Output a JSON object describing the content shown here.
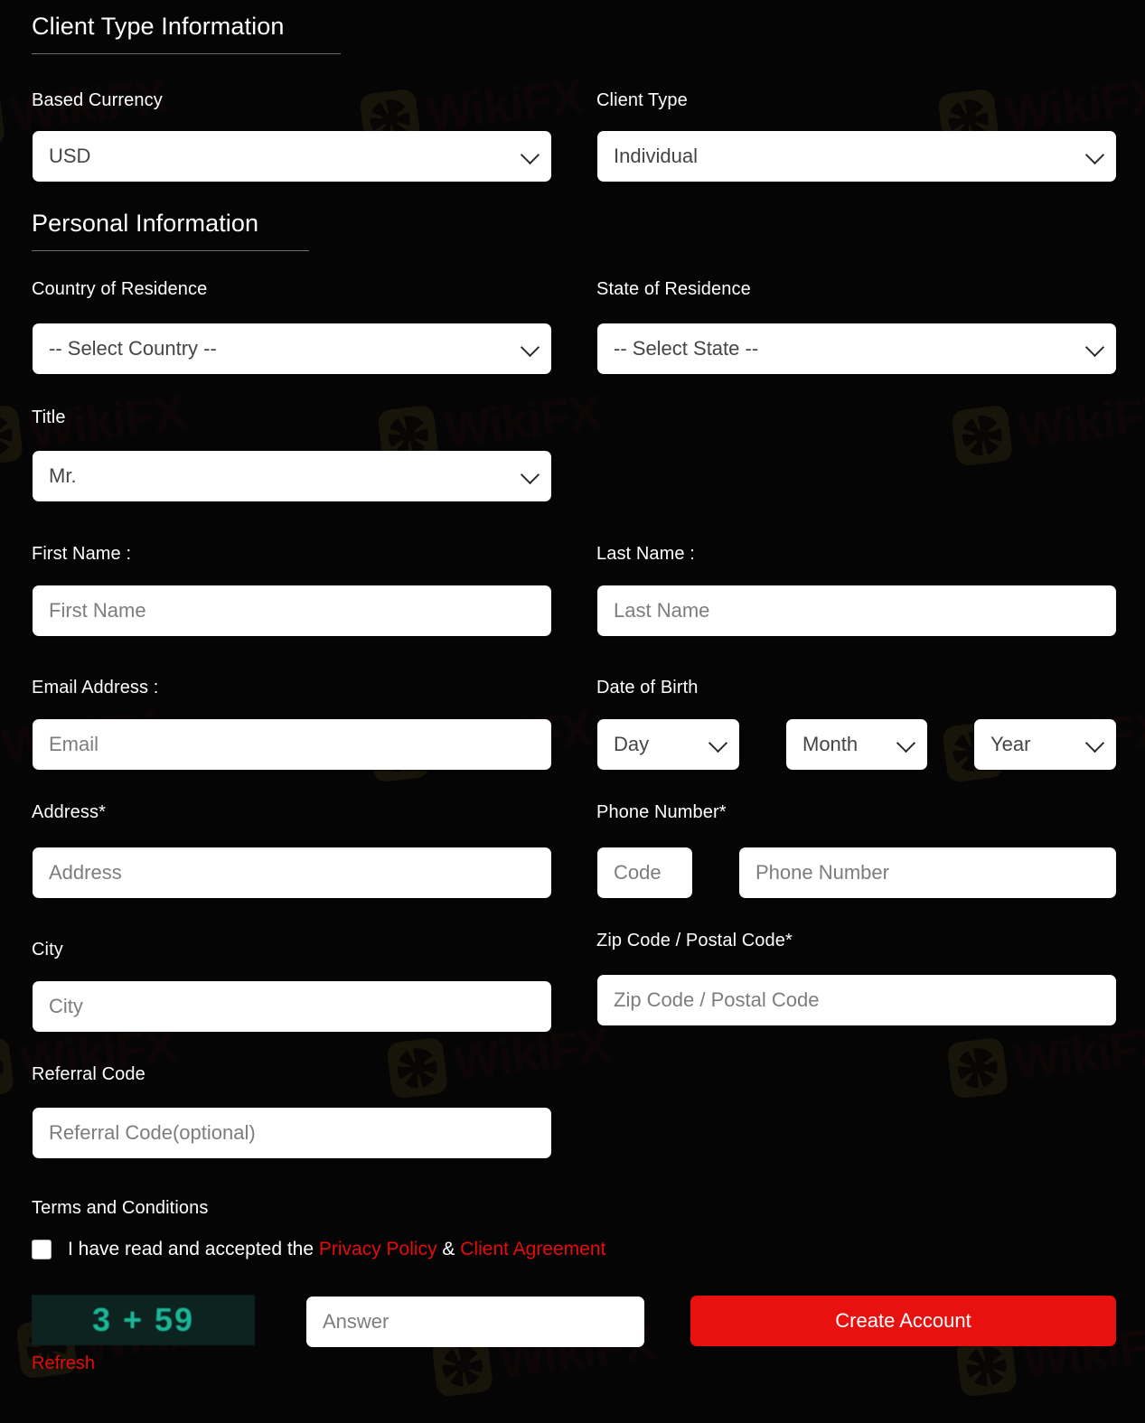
{
  "sections": {
    "client_type": {
      "title": "Client Type Information"
    },
    "personal": {
      "title": "Personal Information"
    }
  },
  "fields": {
    "based_currency": {
      "label": "Based Currency",
      "value": "USD"
    },
    "client_type": {
      "label": "Client Type",
      "value": "Individual"
    },
    "country": {
      "label": "Country of Residence",
      "value": "-- Select Country --"
    },
    "state": {
      "label": "State of Residence",
      "value": "-- Select State --"
    },
    "title": {
      "label": "Title",
      "value": "Mr."
    },
    "first_name": {
      "label": "First Name :",
      "placeholder": "First Name",
      "value": ""
    },
    "last_name": {
      "label": "Last Name :",
      "placeholder": "Last Name",
      "value": ""
    },
    "email": {
      "label": "Email Address :",
      "placeholder": "Email",
      "value": ""
    },
    "dob": {
      "label": "Date of Birth",
      "day": "Day",
      "month": "Month",
      "year": "Year"
    },
    "address": {
      "label": "Address*",
      "placeholder": "Address",
      "value": ""
    },
    "phone": {
      "label": "Phone Number*",
      "code_placeholder": "Code",
      "number_placeholder": "Phone Number",
      "code_value": "",
      "number_value": ""
    },
    "city": {
      "label": "City",
      "placeholder": "City",
      "value": ""
    },
    "zip": {
      "label": "Zip Code / Postal Code*",
      "placeholder": "Zip Code / Postal Code",
      "value": ""
    },
    "referral": {
      "label": "Referral Code",
      "placeholder": "Referral Code(optional)",
      "value": ""
    }
  },
  "terms": {
    "label": "Terms and Conditions",
    "accept_prefix": "I have read and accepted the ",
    "privacy_policy": "Privacy Policy",
    "separator": " & ",
    "client_agreement": "Client Agreement",
    "checked": false
  },
  "captcha": {
    "challenge": "3 + 59",
    "refresh_label": "Refresh",
    "answer_placeholder": "Answer",
    "answer_value": ""
  },
  "actions": {
    "submit_label": "Create Account"
  },
  "watermark": {
    "brand_prefix": "Wi",
    "brand_mid": "kiF",
    "brand_suffix": "X",
    "full": "WikiFX"
  },
  "colors": {
    "background": "#050505",
    "accent_red": "#e8110f",
    "link_red": "#e60c0c",
    "control_bg": "#ffffff",
    "label_text": "#ffffff",
    "captcha_bg": "#0c2320",
    "captcha_text": "#1bb597"
  }
}
